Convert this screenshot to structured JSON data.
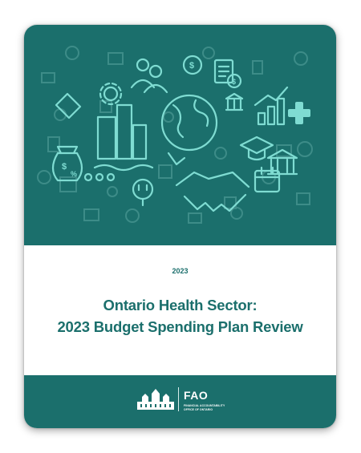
{
  "cover": {
    "year": "2023",
    "title_line1": "Ontario Health Sector:",
    "title_line2": "2023 Budget Spending Plan Review"
  },
  "footer": {
    "logo_word": "FAO",
    "logo_sub_line1": "FINANCIAL ACCOUNTABILITY",
    "logo_sub_line2": "OFFICE OF ONTARIO"
  },
  "colors": {
    "primary": "#1b6f6c",
    "icon_dim": "#3d8c88",
    "icon_bright": "#7fdcd2"
  }
}
